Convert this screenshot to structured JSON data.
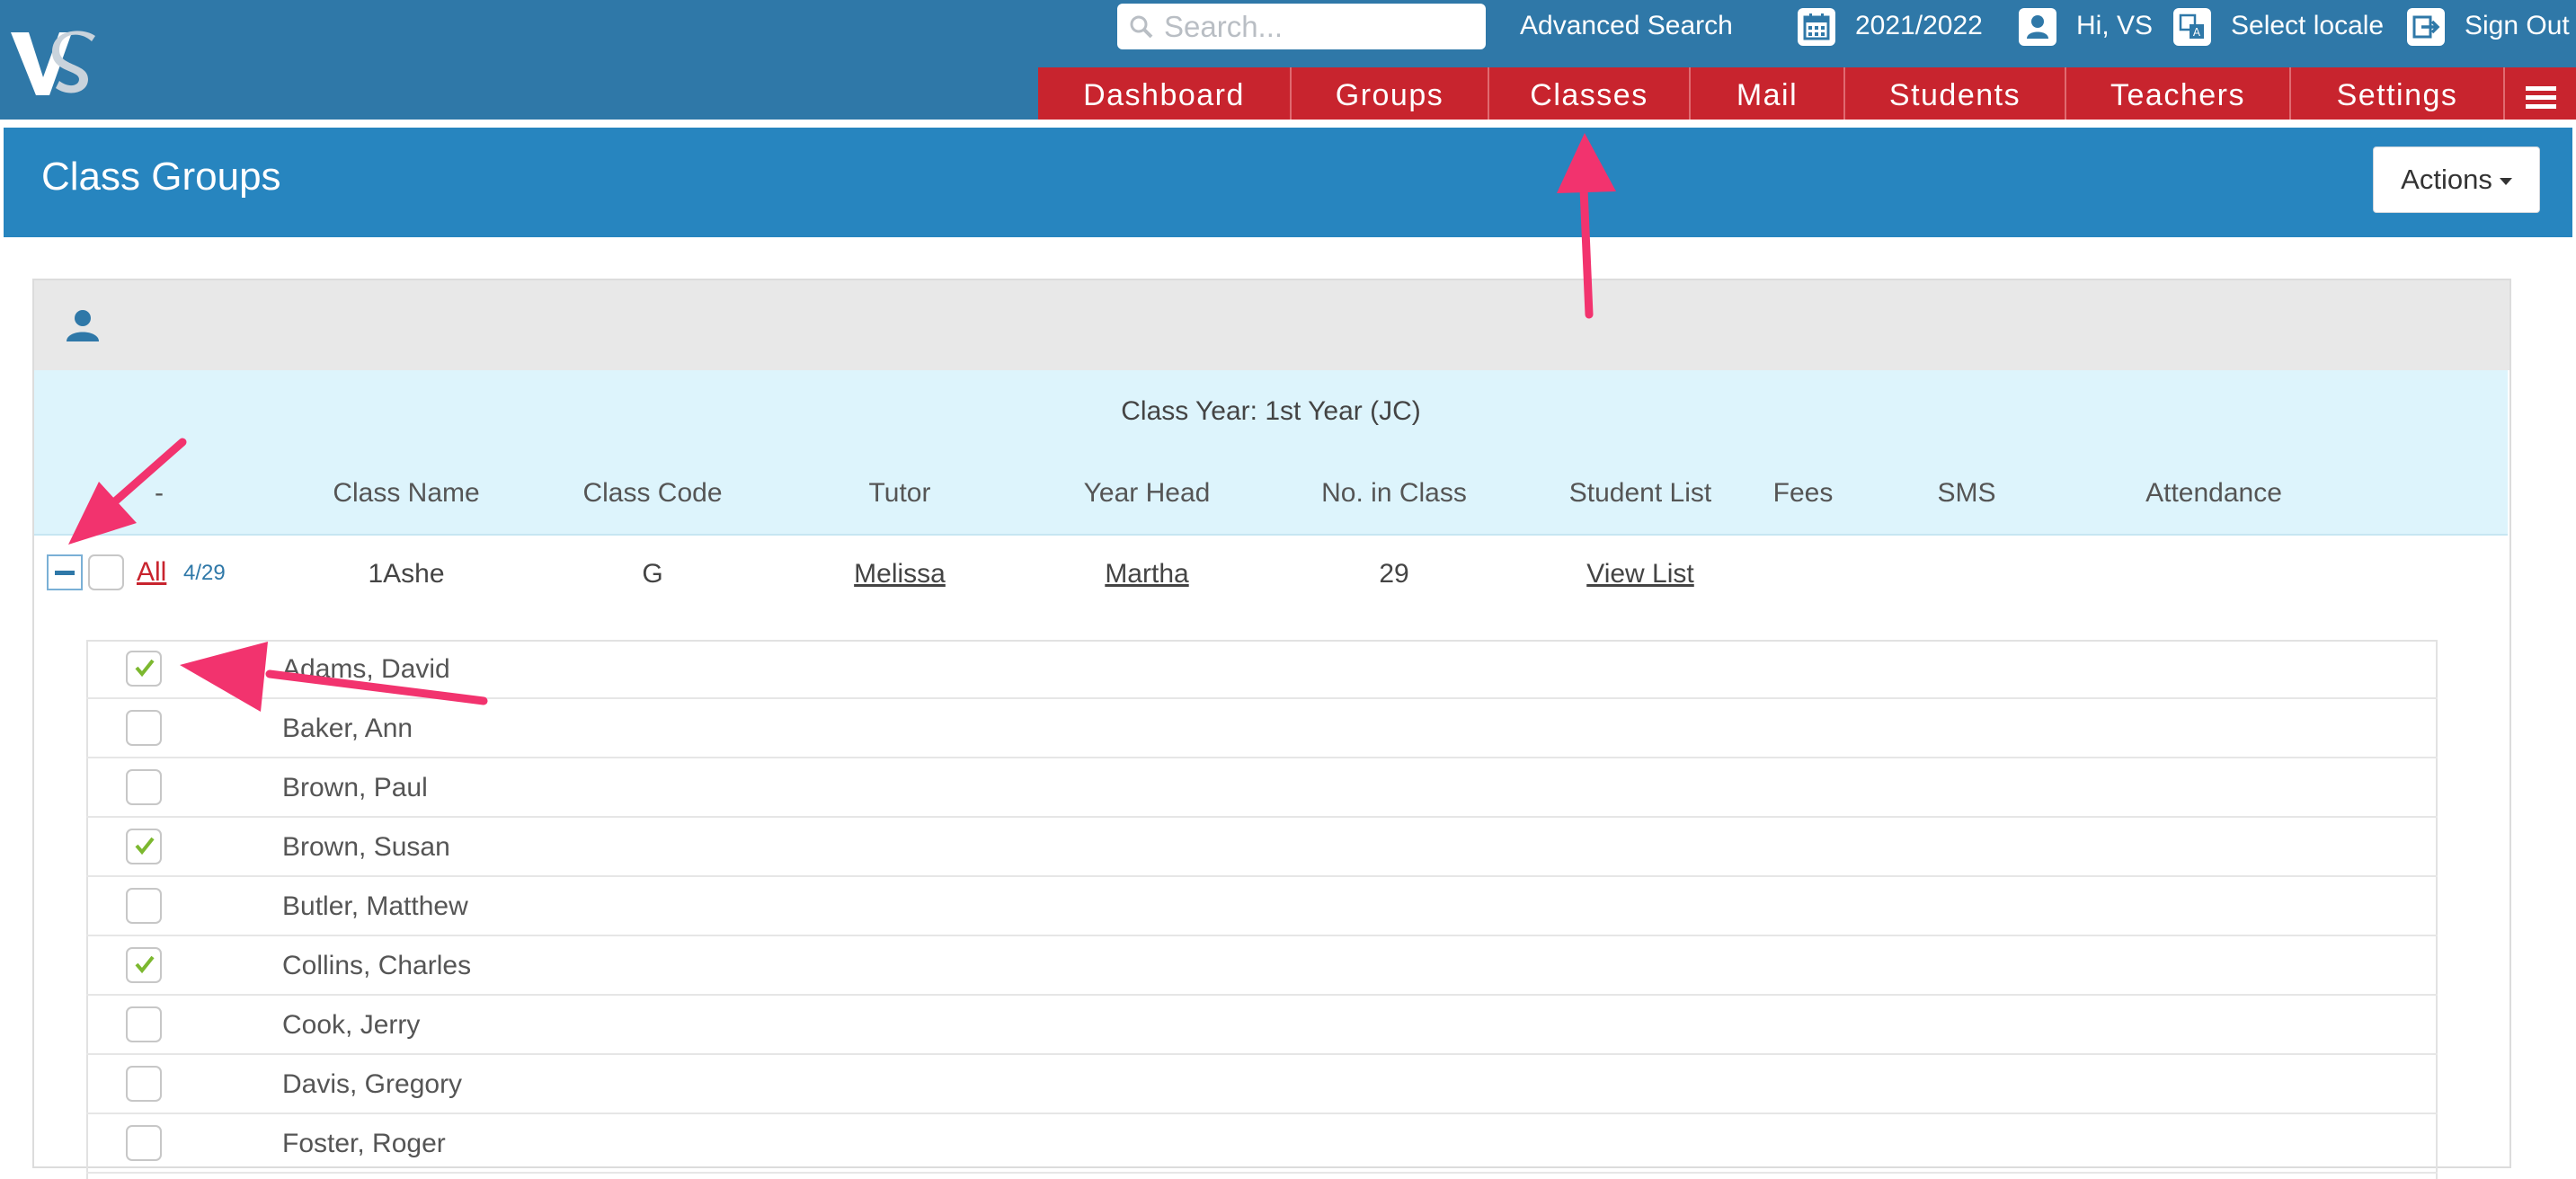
{
  "brand": {
    "logo_text": "VS"
  },
  "topbar": {
    "search_placeholder": "Search...",
    "advanced_search": "Advanced Search",
    "year": "2021/2022",
    "greeting": "Hi, VS",
    "locale": "Select locale",
    "sign_out": "Sign Out"
  },
  "nav": {
    "items": [
      "Dashboard",
      "Groups",
      "Classes",
      "Mail",
      "Students",
      "Teachers",
      "Settings"
    ]
  },
  "page": {
    "title": "Class Groups",
    "actions_label": "Actions"
  },
  "table": {
    "class_year": "Class Year: 1st Year (JC)",
    "columns": [
      "-",
      "Class Name",
      "Class Code",
      "Tutor",
      "Year Head",
      "No. in Class",
      "Student List",
      "Fees",
      "SMS",
      "Attendance"
    ],
    "row": {
      "all_label": "All",
      "selected_count": "4/29",
      "class_name": "1Ashe",
      "class_code": "G",
      "tutor": "Melissa",
      "year_head": "Martha",
      "no_in_class": "29",
      "student_list": "View List"
    }
  },
  "students": [
    {
      "name": "Adams, David",
      "checked": true
    },
    {
      "name": "Baker, Ann",
      "checked": false
    },
    {
      "name": "Brown, Paul",
      "checked": false
    },
    {
      "name": "Brown, Susan",
      "checked": true
    },
    {
      "name": "Butler, Matthew",
      "checked": false
    },
    {
      "name": "Collins, Charles",
      "checked": true
    },
    {
      "name": "Cook, Jerry",
      "checked": false
    },
    {
      "name": "Davis, Gregory",
      "checked": false
    },
    {
      "name": "Foster, Roger",
      "checked": false
    }
  ],
  "colors": {
    "topbar": "#2f78a8",
    "nav": "#c8242e",
    "header_band": "#2785bf",
    "check": "#7cb82f",
    "annotation_arrow": "#f2336e"
  }
}
